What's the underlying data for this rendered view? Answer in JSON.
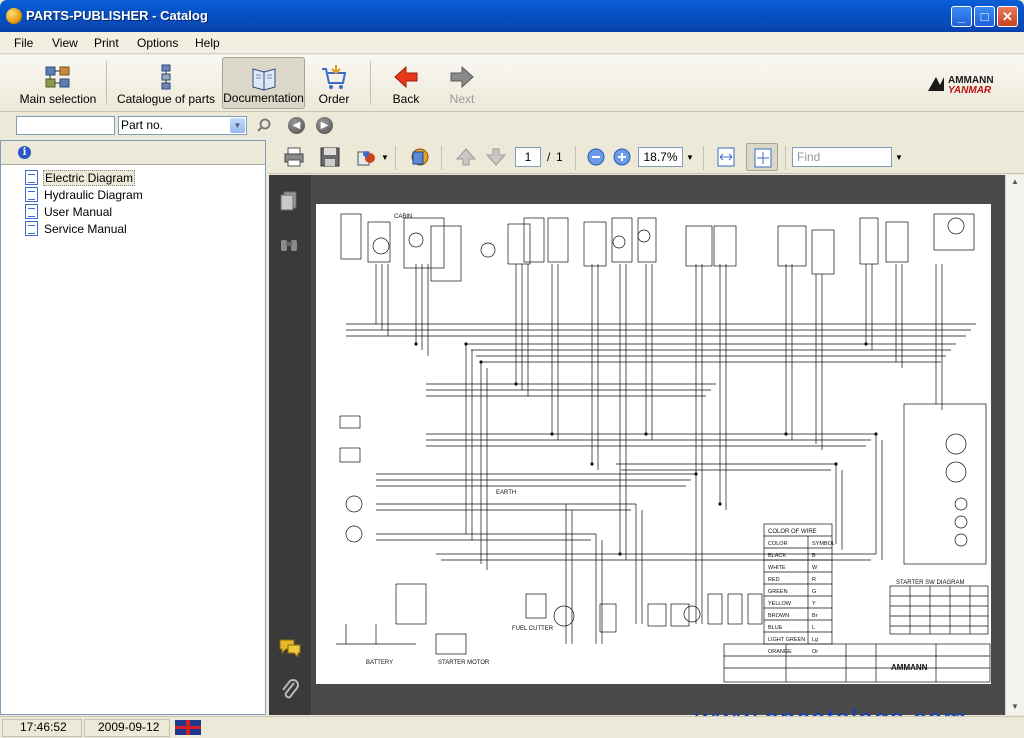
{
  "window": {
    "title": "PARTS-PUBLISHER - Catalog"
  },
  "menu": [
    "File",
    "View",
    "Print",
    "Options",
    "Help"
  ],
  "toolbar": {
    "main_selection": "Main selection",
    "catalogue": "Catalogue of parts",
    "documentation": "Documentation",
    "order": "Order",
    "back": "Back",
    "next": "Next"
  },
  "brand": {
    "line1": "AMMANN",
    "line2": "YANMAR",
    "color": "#1a1a1a"
  },
  "search": {
    "value": "",
    "field_selected": "Part no."
  },
  "tree": {
    "items": [
      "Electric Diagram",
      "Hydraulic Diagram",
      "User Manual",
      "Service Manual"
    ],
    "selected": "Electric Diagram"
  },
  "viewer": {
    "page_current": "1",
    "page_sep": "/",
    "page_total": "1",
    "zoom": "18.7%",
    "find_placeholder": "Find"
  },
  "document": {
    "table_title": "COLOR OF WIRE",
    "table_headers": [
      "COLOR",
      "SYMBOL"
    ],
    "table_rows": [
      [
        "BLACK",
        "B"
      ],
      [
        "WHITE",
        "W"
      ],
      [
        "RED",
        "R"
      ],
      [
        "GREEN",
        "G"
      ],
      [
        "YELLOW",
        "Y"
      ],
      [
        "BROWN",
        "Br"
      ],
      [
        "BLUE",
        "L"
      ],
      [
        "LIGHT GREEN",
        "Lg"
      ],
      [
        "ORANGE",
        "Or"
      ]
    ],
    "starter_title": "STARTER SW DIAGRAM",
    "cabin_label": "CABIN",
    "earth_label": "EARTH",
    "battery_label": "BATTERY",
    "starter_motor_label": "STARTER MOTOR",
    "fuel_label": "FUEL CUTTER",
    "title_brand": "AMMANN"
  },
  "watermark": "www.epcatalogs.com",
  "status": {
    "time": "17:46:52",
    "date": "2009-09-12"
  }
}
